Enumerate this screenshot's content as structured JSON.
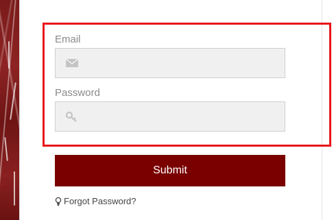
{
  "login_form": {
    "email": {
      "label": "Email",
      "value": "",
      "icon": "envelope-icon"
    },
    "password": {
      "label": "Password",
      "value": "",
      "icon": "key-icon"
    },
    "submit_label": "Submit",
    "forgot_password_label": "Forgot Password?",
    "forgot_password_icon": "lightbulb-icon"
  },
  "colors": {
    "submit_background": "#7a0000",
    "highlight_border": "#e8141a",
    "input_background": "#f0f0f0",
    "side_art": "#7a1a1a"
  }
}
